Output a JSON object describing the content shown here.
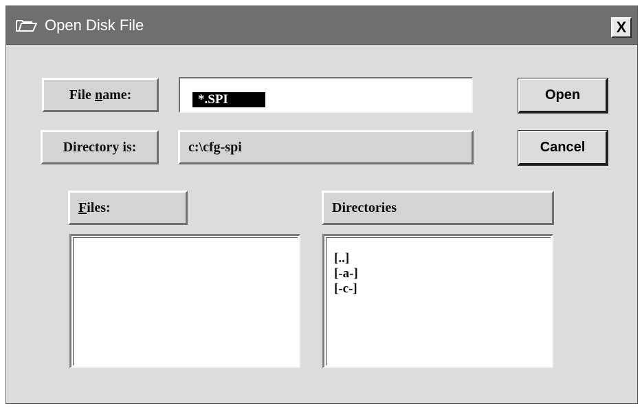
{
  "window": {
    "title": "Open Disk File",
    "close_label": "X"
  },
  "file_name": {
    "label_prefix": "File ",
    "label_underlined": "n",
    "label_suffix": "ame:",
    "value": "*.SPI"
  },
  "directory": {
    "label": "Directory is:",
    "value": "c:\\cfg-spi"
  },
  "buttons": {
    "open": "Open",
    "cancel": "Cancel"
  },
  "files": {
    "label_underlined": "F",
    "label_suffix": "iles:",
    "items": []
  },
  "directories": {
    "label": "Directories",
    "items": [
      "[..]",
      "[-a-]",
      "[-c-]"
    ]
  }
}
